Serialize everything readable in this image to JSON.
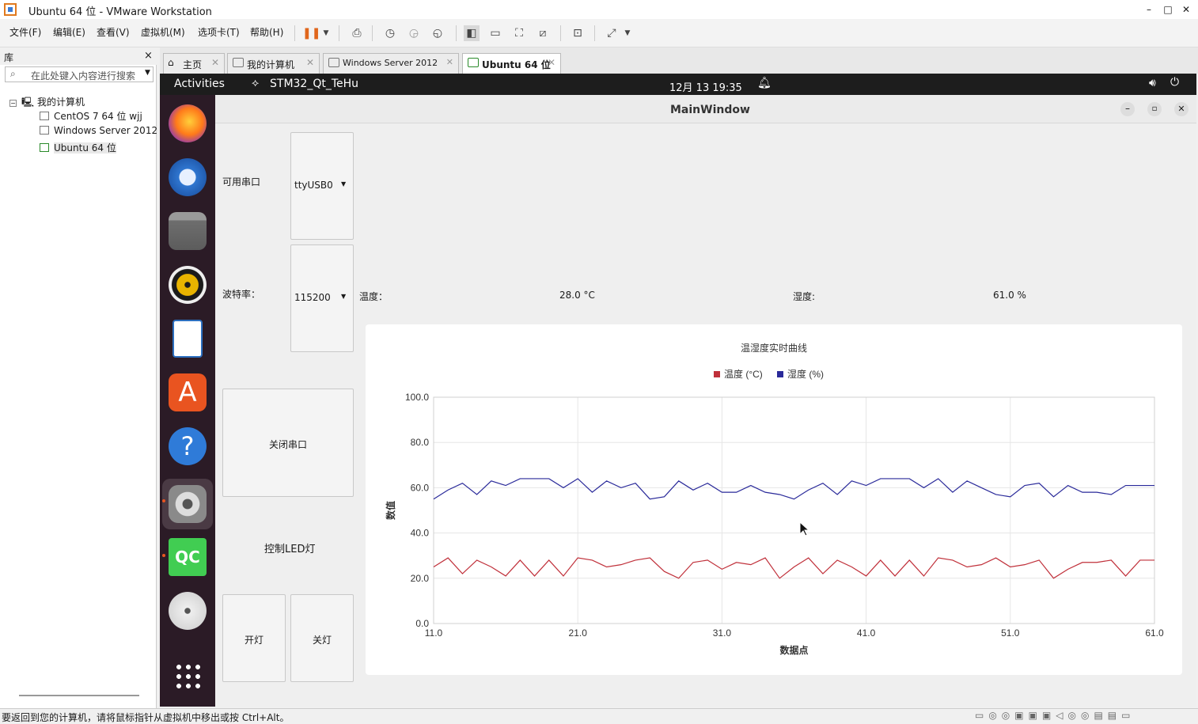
{
  "vmware": {
    "window_title": "Ubuntu 64 位 - VMware Workstation",
    "menu": [
      "文件(F)",
      "编辑(E)",
      "查看(V)",
      "虚拟机(M)",
      "选项卡(T)",
      "帮助(H)"
    ],
    "library_title": "库",
    "library_close": "×",
    "search_placeholder": "在此处键入内容进行搜索",
    "tree": {
      "root": "我的计算机",
      "items": [
        "CentOS 7 64 位 wjj",
        "Windows Server 2012",
        "Ubuntu 64 位"
      ]
    },
    "tabs": [
      "主页",
      "我的计算机",
      "Windows Server 2012",
      "Ubuntu 64 位"
    ],
    "status_text": "要返回到您的计算机，请将鼠标指针从虚拟机中移出或按 Ctrl+Alt。"
  },
  "ubuntu": {
    "activities": "Activities",
    "app_name": "STM32_Qt_TeHu",
    "clock": "12月 13  19:35"
  },
  "app": {
    "window_title": "MainWindow",
    "port_label": "可用串口",
    "port_value": "ttyUSB0",
    "baud_label": "波特率：",
    "baud_value": "115200",
    "close_port_button": "关闭串口",
    "led_label": "控制LED灯",
    "led_on_button": "开灯",
    "led_off_button": "关灯",
    "temp_label": "温度：",
    "temp_value": "28.0 °C",
    "humi_label": "湿度:",
    "humi_value": "61.0 %"
  },
  "chart_data": {
    "type": "line",
    "title": "温湿度实时曲线",
    "xlabel": "数据点",
    "ylabel": "数值",
    "xlim": [
      11,
      61
    ],
    "ylim": [
      0,
      100
    ],
    "xticks": [
      "11.0",
      "21.0",
      "31.0",
      "41.0",
      "51.0",
      "61.0"
    ],
    "yticks": [
      "0.0",
      "20.0",
      "40.0",
      "60.0",
      "80.0",
      "100.0"
    ],
    "grid": true,
    "legend_position": "top",
    "x": [
      11,
      12,
      13,
      14,
      15,
      16,
      17,
      18,
      19,
      20,
      21,
      22,
      23,
      24,
      25,
      26,
      27,
      28,
      29,
      30,
      31,
      32,
      33,
      34,
      35,
      36,
      37,
      38,
      39,
      40,
      41,
      42,
      43,
      44,
      45,
      46,
      47,
      48,
      49,
      50,
      51,
      52,
      53,
      54,
      55,
      56,
      57,
      58,
      59,
      60,
      61
    ],
    "series": [
      {
        "name": "温度 (°C)",
        "color": "#c0303a",
        "values": [
          25,
          29,
          22,
          28,
          25,
          21,
          28,
          21,
          28,
          21,
          29,
          28,
          25,
          26,
          28,
          29,
          23,
          20,
          27,
          28,
          24,
          27,
          26,
          29,
          20,
          25,
          29,
          22,
          28,
          25,
          21,
          28,
          21,
          28,
          21,
          29,
          28,
          25,
          26,
          29,
          25,
          26,
          28,
          20,
          24,
          27,
          27,
          28,
          21,
          28,
          28
        ]
      },
      {
        "name": "湿度 (%)",
        "color": "#2a2a9a",
        "values": [
          55,
          59,
          62,
          57,
          63,
          61,
          64,
          64,
          64,
          60,
          64,
          58,
          63,
          60,
          62,
          55,
          56,
          63,
          59,
          62,
          58,
          58,
          61,
          58,
          57,
          55,
          59,
          62,
          57,
          63,
          61,
          64,
          64,
          64,
          60,
          64,
          58,
          63,
          60,
          57,
          56,
          61,
          62,
          56,
          61,
          58,
          58,
          57,
          61,
          61,
          61
        ]
      }
    ]
  }
}
